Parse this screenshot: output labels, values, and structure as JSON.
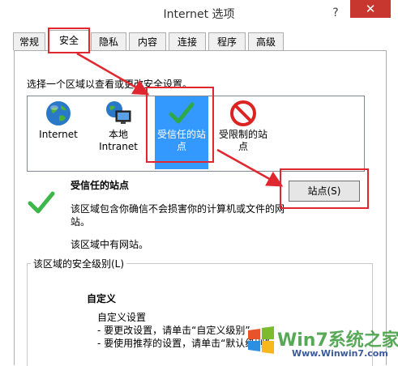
{
  "window": {
    "title": "Internet 选项",
    "help": "?",
    "close": "✕"
  },
  "tabs": [
    "常规",
    "安全",
    "隐私",
    "内容",
    "连接",
    "程序",
    "高级"
  ],
  "zone_prompt": "选择一个区域以查看或更改安全设置。",
  "zones": [
    {
      "label": "Internet",
      "icon": "globe-icon"
    },
    {
      "label": "本地\nIntranet",
      "icon": "intranet-icon"
    },
    {
      "label": "受信任的站\n点",
      "icon": "checkmark-icon"
    },
    {
      "label": "受限制的站\n点",
      "icon": "restricted-icon"
    }
  ],
  "selected_zone": {
    "title": "受信任的站点",
    "description": "该区域包含你确信不会损害你的计算机或文件的网站。",
    "status": "该区域中有网站。",
    "sites_button": "站点(S)"
  },
  "security_level": {
    "group_label": "该区域的安全级别(L)",
    "name": "自定义",
    "lines": [
      "自定义设置",
      "- 要更改设置，请单击“自定义级别”",
      "- 要使用推荐的设置，请单击“默认级别”"
    ]
  },
  "watermark": {
    "text": "Win7系统之家",
    "url": "Www.Winwin7.com"
  },
  "colors": {
    "highlight": "#3399ff",
    "annotation": "#e0262f",
    "close": "#c7372f"
  }
}
